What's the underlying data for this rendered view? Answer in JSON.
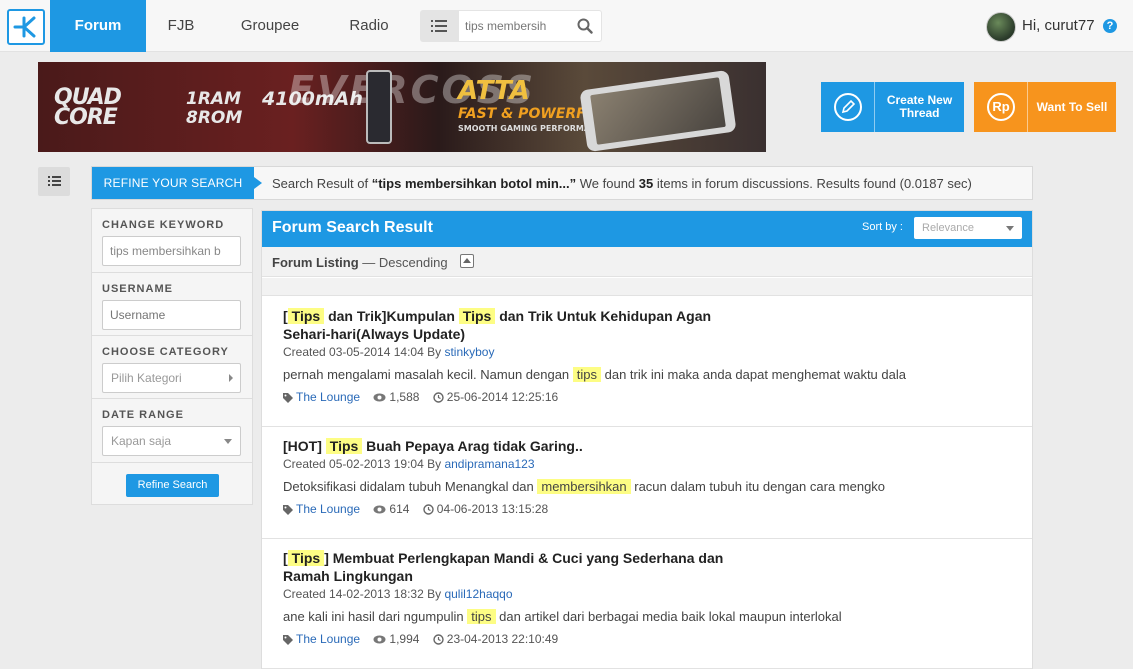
{
  "nav": {
    "items": [
      "Forum",
      "FJB",
      "Groupee",
      "Radio"
    ],
    "search_value": "tips membersih",
    "greeting": "Hi, curut77",
    "help": "?"
  },
  "banner": {
    "line1": "QUAD CORE",
    "line2": "1RAM 8ROM",
    "line3": "4100mAh",
    "brand": "EVERCOSS",
    "product": "ATTA",
    "tagline": "FAST & POWERFUL",
    "sub": "SMOOTH GAMING PERFORMANCE"
  },
  "actions": {
    "create_label": "Create New Thread",
    "sell_label": "Want To Sell",
    "sell_icon_text": "Rp"
  },
  "refine": {
    "tab_label": "REFINE YOUR SEARCH",
    "summary_prefix": "Search Result of ",
    "summary_query": "“tips membersihkan botol min...”",
    "summary_mid": " We found ",
    "summary_count": "35",
    "summary_suffix": " items in forum discussions. Results found (0.0187 sec)"
  },
  "filters": {
    "keyword_label": "CHANGE KEYWORD",
    "keyword_value": "tips membersihkan b",
    "username_label": "USERNAME",
    "username_placeholder": "Username",
    "category_label": "CHOOSE CATEGORY",
    "category_value": "Pilih Kategori",
    "date_label": "DATE RANGE",
    "date_value": "Kapan saja",
    "button_label": "Refine Search"
  },
  "results": {
    "title": "Forum Search Result",
    "sort_label": "Sort by :",
    "sort_value": "Relevance",
    "listing_label": "Forum Listing",
    "listing_order": " — Descending",
    "threads": [
      {
        "title_parts": [
          "[",
          "Tips",
          " dan Trik]Kumpulan ",
          "Tips",
          " dan Trik Untuk Kehidupan Agan Sehari-hari(Always Update)"
        ],
        "created_prefix": "Created 03-05-2014 14:04 By ",
        "author": "stinkyboy",
        "snippet_parts": [
          "pernah mengalami masalah kecil. Namun dengan ",
          "tips",
          " dan trik ini maka anda dapat menghemat waktu dala"
        ],
        "category": "The Lounge",
        "views": "1,588",
        "last": "25-06-2014 12:25:16"
      },
      {
        "title_parts": [
          "[HOT] ",
          "Tips",
          " Buah Pepaya Arag tidak Garing..",
          "",
          ""
        ],
        "created_prefix": "Created 05-02-2013 19:04 By ",
        "author": "andipramana123",
        "snippet_parts": [
          "Detoksifikasi didalam tubuh Menangkal dan ",
          "membersihkan",
          " racun dalam tubuh itu dengan cara mengko"
        ],
        "category": "The Lounge",
        "views": "614",
        "last": "04-06-2013 13:15:28"
      },
      {
        "title_parts": [
          "[",
          "Tips",
          "] Membuat Perlengkapan Mandi & Cuci yang Sederhana dan Ramah Lingkungan",
          "",
          ""
        ],
        "created_prefix": "Created 14-02-2013 18:32 By ",
        "author": "qulil12haqqo",
        "snippet_parts": [
          "ane kali ini hasil dari ngumpulin ",
          "tips",
          " dan artikel dari berbagai media baik lokal maupun interlokal"
        ],
        "category": "The Lounge",
        "views": "1,994",
        "last": "23-04-2013 22:10:49"
      }
    ]
  },
  "colors": {
    "primary": "#1e98e3",
    "accent": "#f7941d",
    "highlight": "#fdfd84"
  },
  "icons": [
    "kaskus-logo-icon",
    "list-icon",
    "search-icon",
    "help-icon",
    "pencil-icon",
    "rupiah-icon",
    "tag-icon",
    "eye-icon",
    "clock-icon",
    "collapse-icon"
  ]
}
